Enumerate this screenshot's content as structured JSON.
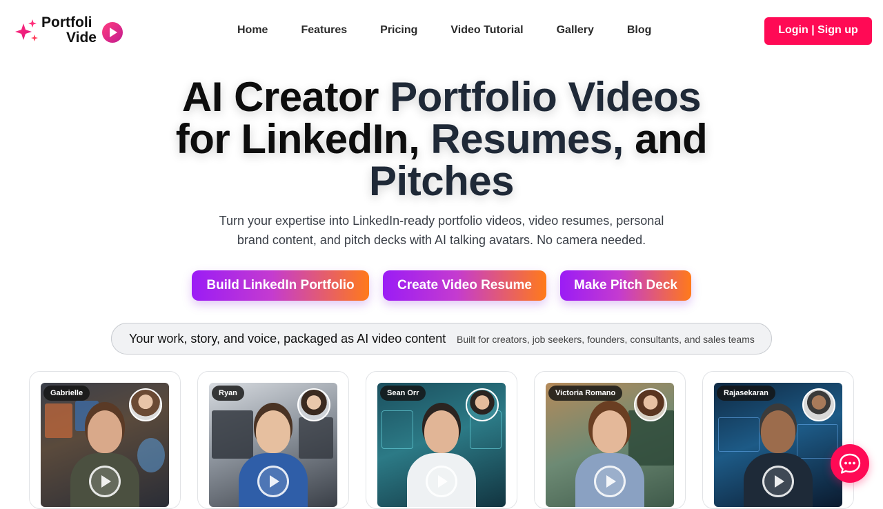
{
  "brand": {
    "line1": "Portfoli",
    "line2": "Vide",
    "accent": "#ff0a55"
  },
  "nav": {
    "items": [
      "Home",
      "Features",
      "Pricing",
      "Video Tutorial",
      "Gallery",
      "Blog"
    ],
    "login_label": "Login | Sign up"
  },
  "hero": {
    "title_part1": "AI Creator ",
    "title_part2": "Portfolio Videos",
    "title_part3": "for LinkedIn, ",
    "title_part4": "Resumes,",
    "title_part5": " and",
    "title_part6": "Pitches",
    "subtitle": "Turn your expertise into LinkedIn-ready portfolio videos, video resumes, personal brand content, and pitch decks with AI talking avatars. No camera needed."
  },
  "cta": {
    "linkedin": "Build LinkedIn Portfolio",
    "resume": "Create Video Resume",
    "pitch": "Make Pitch Deck"
  },
  "pill": {
    "main": "Your work, story, and voice, packaged as AI video content",
    "sub": "Built for creators, job seekers, founders, consultants, and sales teams"
  },
  "cards": [
    {
      "name": "Gabrielle"
    },
    {
      "name": "Ryan"
    },
    {
      "name": "Sean Orr"
    },
    {
      "name": "Victoria Romano"
    },
    {
      "name": "Rajasekaran"
    }
  ],
  "icons": {
    "chat": "chat-bubble-icon",
    "play": "play-icon",
    "sparkle": "sparkle-icon"
  }
}
